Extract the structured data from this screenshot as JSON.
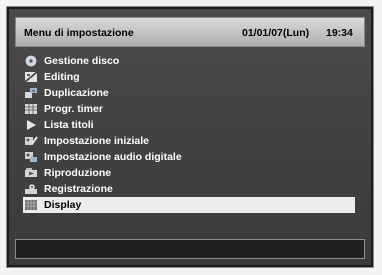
{
  "header": {
    "title": "Menu di impostazione",
    "date": "01/01/07(Lun)",
    "time": "19:34"
  },
  "menu": {
    "items": [
      {
        "label": "Gestione disco",
        "icon": "disc-icon"
      },
      {
        "label": "Editing",
        "icon": "film-edit-icon"
      },
      {
        "label": "Duplicazione",
        "icon": "dub-icon"
      },
      {
        "label": "Progr. timer",
        "icon": "timer-grid-icon"
      },
      {
        "label": "Lista titoli",
        "icon": "play-icon"
      },
      {
        "label": "Impostazione iniziale",
        "icon": "initial-setup-icon"
      },
      {
        "label": "Impostazione audio digitale",
        "icon": "digital-audio-icon"
      },
      {
        "label": "Riproduzione",
        "icon": "playback-icon"
      },
      {
        "label": "Registrazione",
        "icon": "record-icon"
      },
      {
        "label": "Display",
        "icon": "display-icon",
        "selected": true
      }
    ]
  },
  "colors": {
    "screen_bg": "#3f3f3f",
    "header_bg": "#c7c7c7",
    "selected_bg": "#ececec",
    "text": "#ffffff"
  }
}
